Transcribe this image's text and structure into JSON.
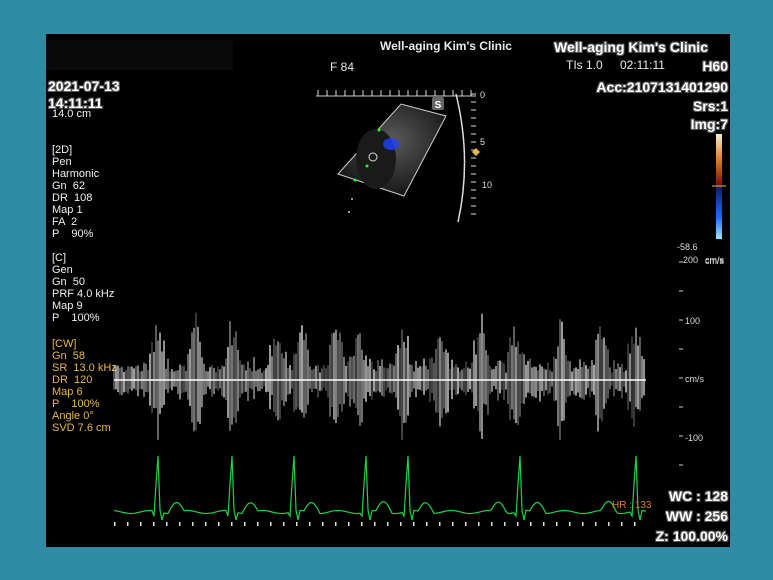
{
  "header": {
    "clinic_center": "Well-aging Kim's Clinic",
    "clinic_right": "Well-aging Kim's Clinic",
    "freq": "F 84",
    "tis": "TIs  1.0",
    "time": "02:11:11",
    "probe": "H60",
    "date": "2021-07-13",
    "clock": "14:11:11",
    "depth": "14.0 cm",
    "acc": "Acc:2107131401290",
    "srs": "Srs:1",
    "img": "Img:7",
    "s_badge": "S"
  },
  "depth_scale": [
    "0",
    "5",
    "10"
  ],
  "color_bar": {
    "min_label": "-58.6",
    "unit": "cm/s",
    "top": "#f5f0d0",
    "mid": "#7a1010",
    "bottom": "#1a6cff"
  },
  "settings_2d": [
    "[2D]",
    "Pen",
    "Harmonic",
    "Gn  62",
    "DR  108",
    "Map 1",
    "FA  2",
    "P    90%"
  ],
  "settings_c": [
    "[C]",
    "Gen",
    "Gn  50",
    "PRF 4.0 kHz",
    "Map 9",
    "P    100%"
  ],
  "settings_cw": [
    "[CW]",
    "Gn  58",
    "SR  13.0 kHz",
    "DR  120",
    "Map 6",
    "P    100%",
    "Angle 0°",
    "SVD 7.6 cm"
  ],
  "velocity_scale": {
    "top": "200",
    "unit_top": "cm/s",
    "v100": "100",
    "zero_unit": "cm/s",
    "vneg": "-100"
  },
  "ecg": {
    "hr_label": "HR",
    "hr_value": "133",
    "color": "#1fd24a"
  },
  "footer": {
    "wc": "WC : 128",
    "ww": "WW : 256",
    "zoom": "Z: 100.00%"
  }
}
